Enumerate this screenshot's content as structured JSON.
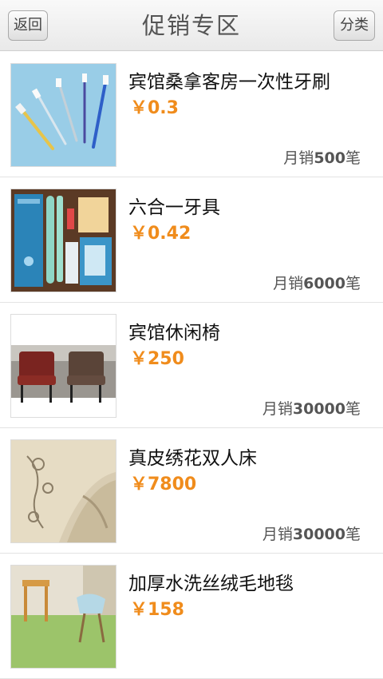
{
  "header": {
    "back_label": "返回",
    "title": "促销专区",
    "category_label": "分类"
  },
  "products": [
    {
      "name": "宾馆桑拿客房一次性牙刷",
      "price": "￥0.3",
      "sales_prefix": "月销",
      "sales_count": "500",
      "sales_suffix": "笔",
      "image": "toothbrushes"
    },
    {
      "name": "六合一牙具",
      "price": "￥0.42",
      "sales_prefix": "月销",
      "sales_count": "6000",
      "sales_suffix": "笔",
      "image": "dental-kit"
    },
    {
      "name": "宾馆休闲椅",
      "price": "￥250",
      "sales_prefix": "月销",
      "sales_count": "30000",
      "sales_suffix": "笔",
      "image": "chairs"
    },
    {
      "name": "真皮绣花双人床",
      "price": "￥7800",
      "sales_prefix": "月销",
      "sales_count": "30000",
      "sales_suffix": "笔",
      "image": "leather-bed"
    },
    {
      "name": "加厚水洗丝绒毛地毯",
      "price": "￥158",
      "sales_prefix": "",
      "sales_count": "",
      "sales_suffix": "",
      "image": "carpet"
    }
  ],
  "colors": {
    "price": "#f08c1c",
    "header_bg": "#efefef"
  }
}
